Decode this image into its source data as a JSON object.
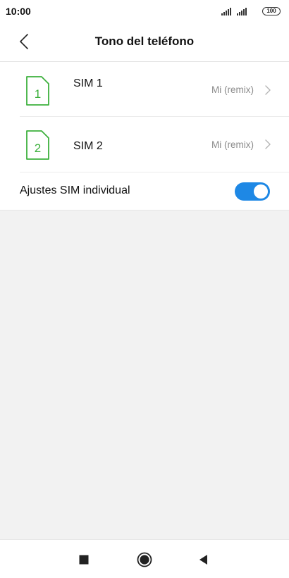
{
  "status_bar": {
    "time": "10:00",
    "battery_level": "100",
    "icons": [
      "signal-icon",
      "signal-icon",
      "battery-icon"
    ]
  },
  "header": {
    "title": "Tono del teléfono",
    "back_icon": "chevron-left-icon"
  },
  "sim_list": [
    {
      "badge": "1",
      "name": "SIM 1",
      "value": "Mi (remix)",
      "icon": "sim-card-icon"
    },
    {
      "badge": "2",
      "name": "SIM 2",
      "value": "Mi (remix)",
      "icon": "sim-card-icon"
    }
  ],
  "individual_settings": {
    "label": "Ajustes SIM individual",
    "enabled": true
  },
  "colors": {
    "accent": "#1e88e5",
    "sim_green": "#3db03d",
    "secondary_text": "#8a8a8a"
  },
  "nav_bar": {
    "icons": [
      "recents-square-icon",
      "home-circle-icon",
      "back-triangle-icon"
    ]
  }
}
